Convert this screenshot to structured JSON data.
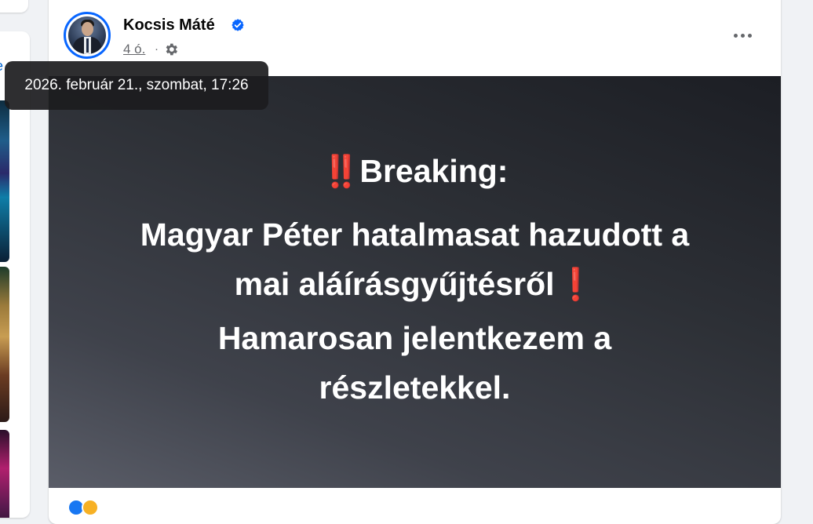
{
  "author": {
    "name": "Kocsis Máté",
    "verified": true,
    "avatar_description": "profile photo"
  },
  "post_meta": {
    "time_ago": "4 ó.",
    "separator": "·",
    "audience_icon": "gear-icon"
  },
  "tooltip": {
    "text": "2026. február 21., szombat, 17:26"
  },
  "post_media": {
    "line_1": {
      "emoji": "‼️",
      "text": "Breaking:"
    },
    "line_2": "Magyar Péter hatalmasat hazudott a",
    "line_3": {
      "text": "mai aláírásgyűjtésről",
      "emoji": "❗"
    },
    "line_4": "Hamarosan jelentkezem a",
    "line_5": "részletekkel."
  },
  "left_column": {
    "partial_link_text": "e"
  },
  "colors": {
    "page_background": "#f0f2f5",
    "card_background": "#ffffff",
    "verified_blue": "#0866ff",
    "avatar_ring": "#0866ff",
    "emoji_red": "#e02b2b",
    "tooltip_background": "#1c1c1e",
    "media_text": "#ffffff"
  },
  "icons": {
    "verified": "verified-badge-icon",
    "audience": "gear-icon",
    "more": "more-horizontal-icon"
  }
}
